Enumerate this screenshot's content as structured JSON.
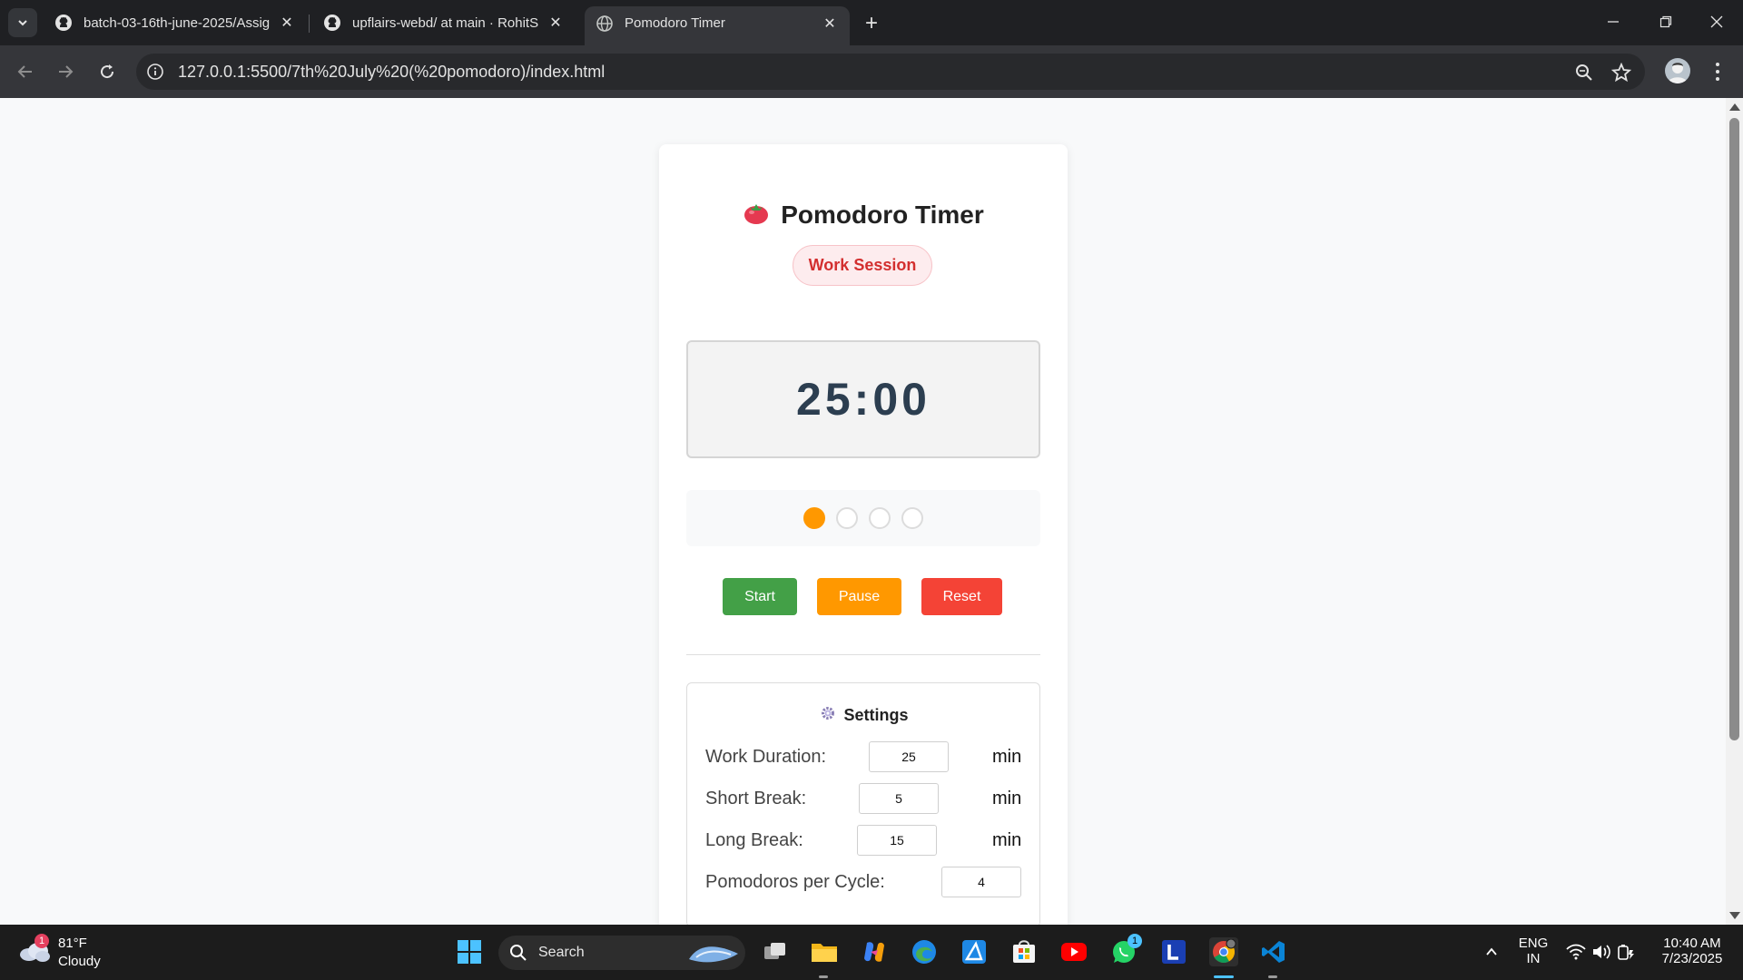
{
  "browser": {
    "tabs": [
      {
        "title": "batch-03-16th-june-2025/Assig",
        "icon": "github-icon"
      },
      {
        "title": "upflairs-webd/ at main · RohitS",
        "icon": "github-icon"
      },
      {
        "title": "Pomodoro Timer",
        "icon": "globe-icon",
        "active": true
      }
    ],
    "url": "127.0.0.1:5500/7th%20July%20(%20pomodoro)/index.html"
  },
  "app": {
    "title": "Pomodoro Timer",
    "title_emoji": "tomato-icon",
    "session_badge": "Work Session",
    "timer": "25:00",
    "progress": {
      "completed": 1,
      "total": 4
    },
    "buttons": {
      "start": "Start",
      "pause": "Pause",
      "reset": "Reset"
    },
    "colors": {
      "start": "#43a047",
      "pause": "#ff9800",
      "reset": "#f44336",
      "badge": "#d32f2f"
    },
    "settings": {
      "heading": "Settings",
      "work_label": "Work Duration:",
      "work_value": "25",
      "short_label": "Short Break:",
      "short_value": "5",
      "long_label": "Long Break:",
      "long_value": "15",
      "cycle_label": "Pomodoros per Cycle:",
      "cycle_value": "4",
      "unit": "min"
    }
  },
  "taskbar": {
    "weather_temp": "81°F",
    "weather_cond": "Cloudy",
    "weather_badge": "1",
    "search_label": "Search",
    "whatsapp_badge": "1",
    "lang": "ENG",
    "region": "IN",
    "time": "10:40 AM",
    "date": "7/23/2025"
  }
}
